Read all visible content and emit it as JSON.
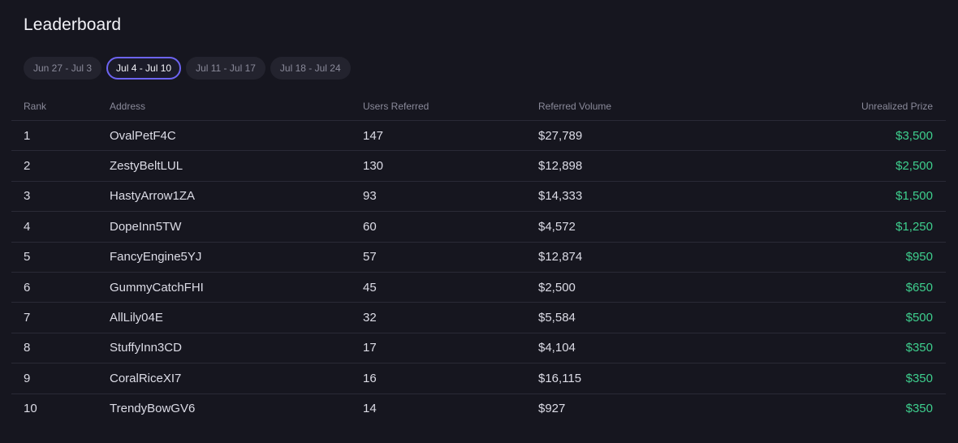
{
  "header": {
    "title": "Leaderboard"
  },
  "tabs": [
    {
      "label": "Jun 27 - Jul 3",
      "active": false
    },
    {
      "label": "Jul 4 - Jul 10",
      "active": true
    },
    {
      "label": "Jul 11 - Jul 17",
      "active": false
    },
    {
      "label": "Jul 18 - Jul 24",
      "active": false
    }
  ],
  "table": {
    "columns": {
      "rank": "Rank",
      "address": "Address",
      "users": "Users Referred",
      "volume": "Referred Volume",
      "prize": "Unrealized Prize"
    },
    "rows": [
      {
        "rank": "1",
        "address": "OvalPetF4C",
        "users": "147",
        "volume": "$27,789",
        "prize": "$3,500"
      },
      {
        "rank": "2",
        "address": "ZestyBeltLUL",
        "users": "130",
        "volume": "$12,898",
        "prize": "$2,500"
      },
      {
        "rank": "3",
        "address": "HastyArrow1ZA",
        "users": "93",
        "volume": "$14,333",
        "prize": "$1,500"
      },
      {
        "rank": "4",
        "address": "DopeInn5TW",
        "users": "60",
        "volume": "$4,572",
        "prize": "$1,250"
      },
      {
        "rank": "5",
        "address": "FancyEngine5YJ",
        "users": "57",
        "volume": "$12,874",
        "prize": "$950"
      },
      {
        "rank": "6",
        "address": "GummyCatchFHI",
        "users": "45",
        "volume": "$2,500",
        "prize": "$650"
      },
      {
        "rank": "7",
        "address": "AllLily04E",
        "users": "32",
        "volume": "$5,584",
        "prize": "$500"
      },
      {
        "rank": "8",
        "address": "StuffyInn3CD",
        "users": "17",
        "volume": "$4,104",
        "prize": "$350"
      },
      {
        "rank": "9",
        "address": "CoralRiceXI7",
        "users": "16",
        "volume": "$16,115",
        "prize": "$350"
      },
      {
        "rank": "10",
        "address": "TrendyBowGV6",
        "users": "14",
        "volume": "$927",
        "prize": "$350"
      }
    ]
  },
  "colors": {
    "background": "#16161f",
    "accent": "#6d64f2",
    "prize": "#3ecf8e"
  }
}
